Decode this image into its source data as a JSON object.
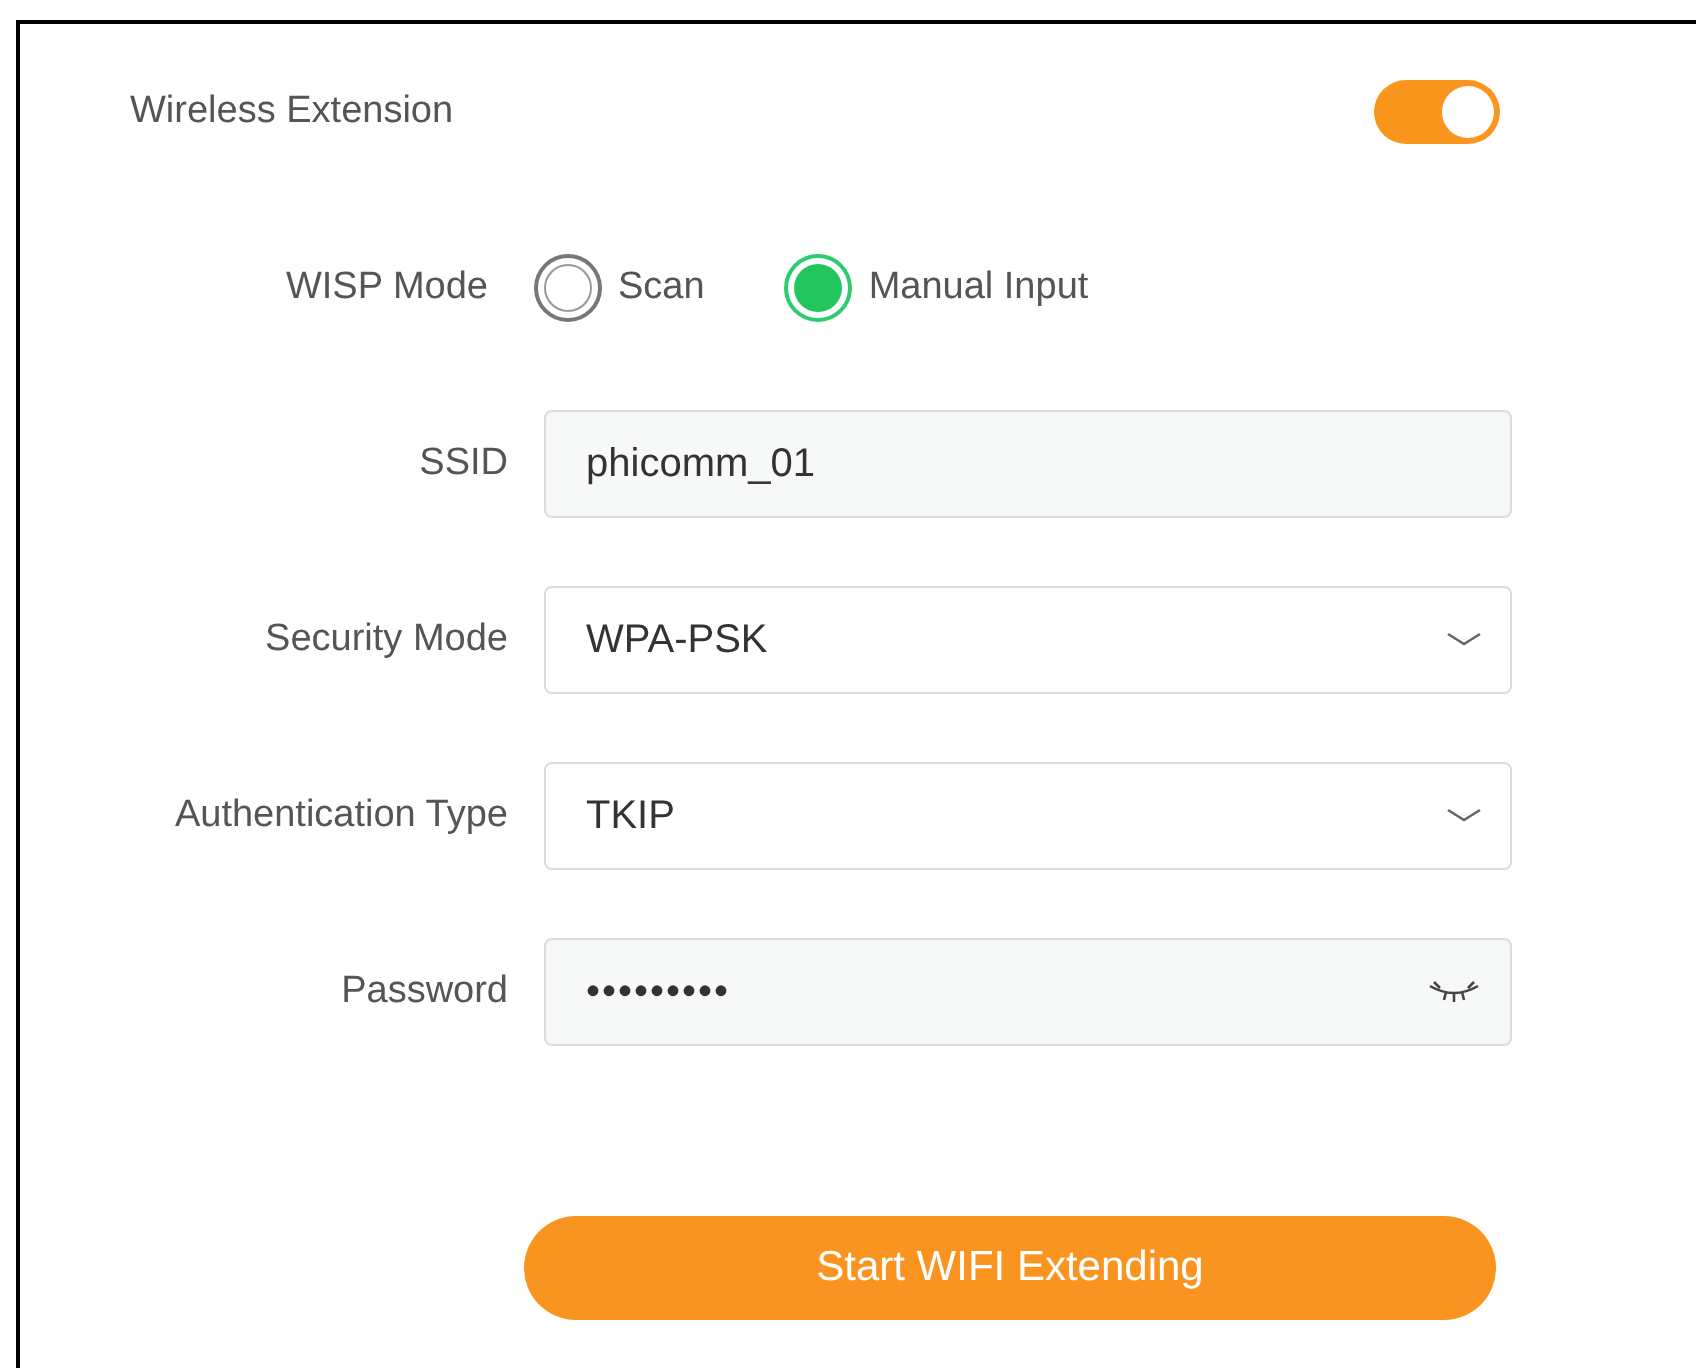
{
  "extension": {
    "label": "Wireless Extension",
    "on": true
  },
  "wisp_mode": {
    "label": "WISP Mode",
    "options": [
      {
        "label": "Scan",
        "selected": false
      },
      {
        "label": "Manual Input",
        "selected": true
      }
    ]
  },
  "fields": [
    {
      "kind": "text",
      "label": "SSID",
      "value": "phicomm_01"
    },
    {
      "kind": "select",
      "label": "Security Mode",
      "value": "WPA-PSK"
    },
    {
      "kind": "select",
      "label": "Authentication Type",
      "value": "TKIP"
    },
    {
      "kind": "password",
      "label": "Password",
      "value": "•••••••••"
    }
  ],
  "submit": "Start WIFI Extending"
}
